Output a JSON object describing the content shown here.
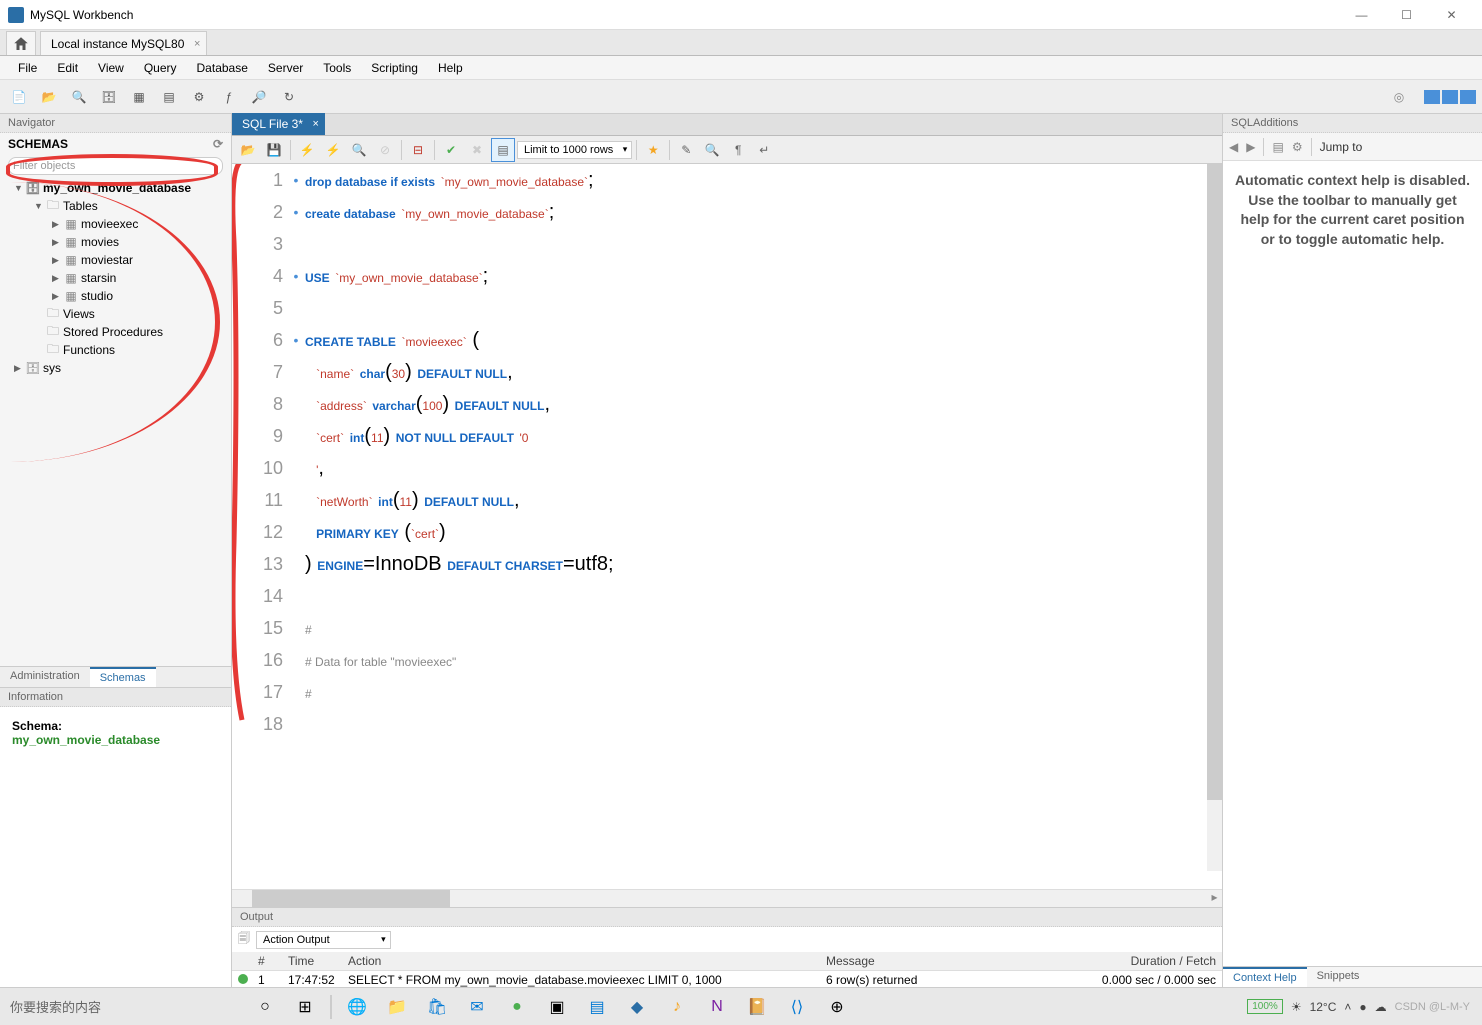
{
  "window": {
    "title": "MySQL Workbench"
  },
  "connection_tab": "Local instance MySQL80",
  "menus": [
    "File",
    "Edit",
    "View",
    "Query",
    "Database",
    "Server",
    "Tools",
    "Scripting",
    "Help"
  ],
  "navigator": {
    "title": "Navigator",
    "section": "SCHEMAS",
    "filter_placeholder": "Filter objects",
    "tree": {
      "db": "my_own_movie_database",
      "tables_label": "Tables",
      "tables": [
        "movieexec",
        "movies",
        "moviestar",
        "starsin",
        "studio"
      ],
      "views": "Views",
      "sp": "Stored Procedures",
      "fn": "Functions",
      "sys": "sys"
    },
    "tabs": {
      "admin": "Administration",
      "schemas": "Schemas"
    },
    "info": {
      "title": "Information",
      "label": "Schema:",
      "value": "my_own_movie_database"
    }
  },
  "editor": {
    "tab_name": "SQL File 3*",
    "limit": "Limit to 1000 rows",
    "lines": [
      {
        "n": 1,
        "dot": true,
        "html": "<span class='kw'>drop database if exists</span> <span class='ident'>`my_own_movie_database`</span>;"
      },
      {
        "n": 2,
        "dot": true,
        "html": "<span class='kw'>create database</span> <span class='ident'>`my_own_movie_database`</span>;"
      },
      {
        "n": 3,
        "dot": false,
        "html": ""
      },
      {
        "n": 4,
        "dot": true,
        "html": "<span class='kw'>USE</span> <span class='ident'>`my_own_movie_database`</span>;"
      },
      {
        "n": 5,
        "dot": false,
        "html": ""
      },
      {
        "n": 6,
        "dot": true,
        "html": "<span class='kw'>CREATE TABLE</span> <span class='ident'>`movieexec`</span> ("
      },
      {
        "n": 7,
        "dot": false,
        "html": "  <span class='ident'>`name`</span> <span class='kw'>char</span>(<span class='num'>30</span>) <span class='kw'>DEFAULT NULL</span>,"
      },
      {
        "n": 8,
        "dot": false,
        "html": "  <span class='ident'>`address`</span> <span class='kw'>varchar</span>(<span class='num'>100</span>) <span class='kw'>DEFAULT NULL</span>,"
      },
      {
        "n": 9,
        "dot": false,
        "html": "  <span class='ident'>`cert`</span> <span class='kw'>int</span>(<span class='num'>11</span>) <span class='kw'>NOT NULL DEFAULT</span> <span class='str'>'0</span>"
      },
      {
        "n": 10,
        "dot": false,
        "html": "  <span class='str'>'</span>,"
      },
      {
        "n": 11,
        "dot": false,
        "html": "  <span class='ident'>`netWorth`</span> <span class='kw'>int</span>(<span class='num'>11</span>) <span class='kw'>DEFAULT NULL</span>,"
      },
      {
        "n": 12,
        "dot": false,
        "html": "  <span class='kw'>PRIMARY KEY</span> (<span class='ident'>`cert`</span>)"
      },
      {
        "n": 13,
        "dot": false,
        "html": ") <span class='kw'>ENGINE</span>=InnoDB <span class='kw'>DEFAULT CHARSET</span>=utf8;"
      },
      {
        "n": 14,
        "dot": false,
        "html": ""
      },
      {
        "n": 15,
        "dot": false,
        "html": "<span class='cmt'>#</span>"
      },
      {
        "n": 16,
        "dot": false,
        "html": "<span class='cmt'># Data for table \"movieexec\"</span>"
      },
      {
        "n": 17,
        "dot": false,
        "html": "<span class='cmt'>#</span>"
      },
      {
        "n": 18,
        "dot": false,
        "html": ""
      }
    ]
  },
  "additions": {
    "title": "SQLAdditions",
    "jump": "Jump to",
    "help_text": "Automatic context help is disabled. Use the toolbar to manually get help for the current caret position or to toggle automatic help.",
    "tabs": {
      "ctx": "Context Help",
      "snip": "Snippets"
    }
  },
  "output": {
    "title": "Output",
    "dropdown": "Action Output",
    "headers": {
      "n": "#",
      "time": "Time",
      "action": "Action",
      "msg": "Message",
      "dur": "Duration / Fetch"
    },
    "row": {
      "n": "1",
      "time": "17:47:52",
      "action": "SELECT * FROM my_own_movie_database.movieexec LIMIT 0, 1000",
      "msg": "6 row(s) returned",
      "dur": "0.000 sec / 0.000 sec"
    }
  },
  "taskbar": {
    "search": "你要搜索的内容",
    "temp": "12°C",
    "watermark": "CSDN @L-M-Y"
  }
}
